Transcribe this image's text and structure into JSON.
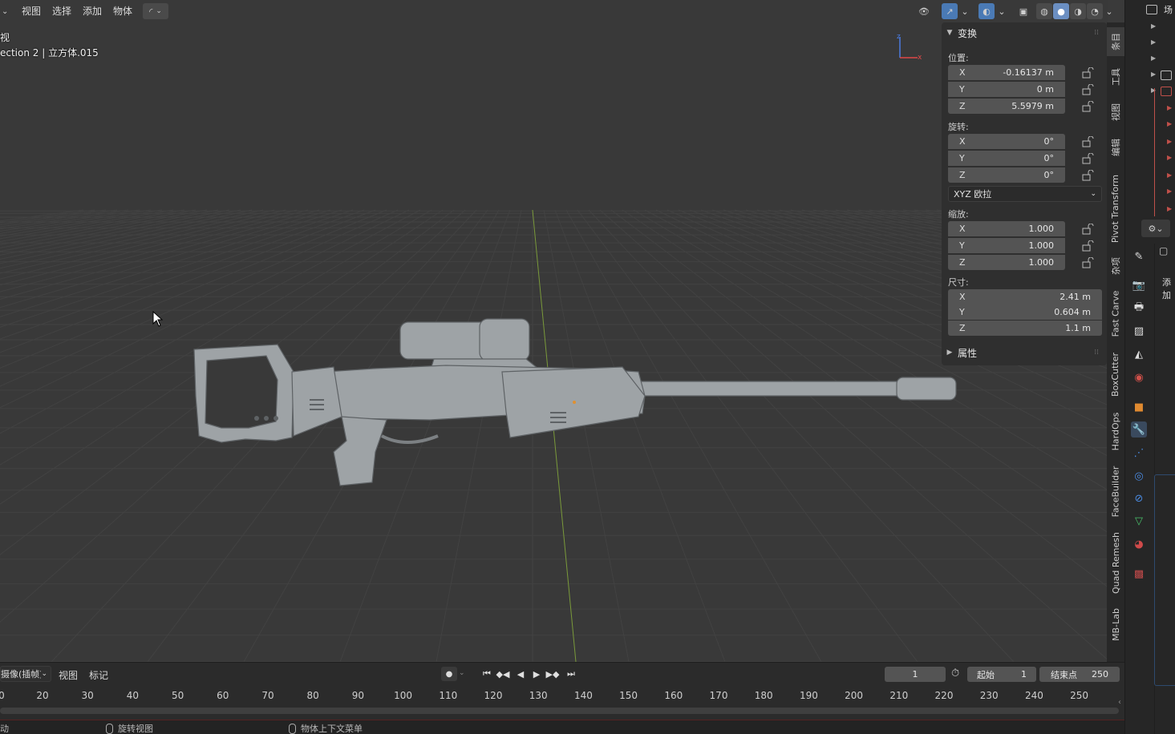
{
  "header": {
    "menu": [
      "视图",
      "选择",
      "添加",
      "物体"
    ]
  },
  "viewport": {
    "overlay_line1": "视",
    "overlay_line2": "ection 2 | 立方体.015"
  },
  "npanel": {
    "transform_title": "变换",
    "location_label": "位置:",
    "location": [
      {
        "axis": "X",
        "value": "-0.16137 m"
      },
      {
        "axis": "Y",
        "value": "0 m"
      },
      {
        "axis": "Z",
        "value": "5.5979 m"
      }
    ],
    "rotation_label": "旋转:",
    "rotation": [
      {
        "axis": "X",
        "value": "0°"
      },
      {
        "axis": "Y",
        "value": "0°"
      },
      {
        "axis": "Z",
        "value": "0°"
      }
    ],
    "rotation_mode": "XYZ 欧拉",
    "scale_label": "缩放:",
    "scale": [
      {
        "axis": "X",
        "value": "1.000"
      },
      {
        "axis": "Y",
        "value": "1.000"
      },
      {
        "axis": "Z",
        "value": "1.000"
      }
    ],
    "dimensions_label": "尺寸:",
    "dimensions": [
      {
        "axis": "X",
        "value": "2.41 m"
      },
      {
        "axis": "Y",
        "value": "0.604 m"
      },
      {
        "axis": "Z",
        "value": "1.1 m"
      }
    ],
    "properties_title": "属性"
  },
  "vtabs": [
    "条目",
    "工具",
    "视图",
    "编辑",
    "Pivot Transform",
    "杂项",
    "Fast Carve",
    "BoxCutter",
    "HardOps",
    "FaceBuilder",
    "Quad Remesh",
    "MB-Lab"
  ],
  "right_strip": {
    "scene_label": "场",
    "add_label": "添加"
  },
  "timeline": {
    "mode": "摄像(插帧)",
    "view": "视图",
    "marker": "标记",
    "current_frame": "1",
    "start_label": "起始",
    "start": "1",
    "end_label": "结束点",
    "end": "250",
    "ticks": [
      "0",
      "20",
      "30",
      "40",
      "50",
      "60",
      "70",
      "80",
      "90",
      "100",
      "110",
      "120",
      "130",
      "140",
      "150",
      "160",
      "170",
      "180",
      "190",
      "200",
      "210",
      "220",
      "230",
      "240",
      "250"
    ]
  },
  "statusbar": {
    "left": "动",
    "item1": "旋转视图",
    "item2": "物体上下文菜单"
  },
  "colors": {
    "viewport_bg": "#393939",
    "panel_bg": "#2f2f2f",
    "field_bg": "#545454",
    "accent_blue": "#4a7ab5",
    "x_axis": "#e04848",
    "y_axis": "#7ab045",
    "z_axis": "#4a7ae0"
  }
}
